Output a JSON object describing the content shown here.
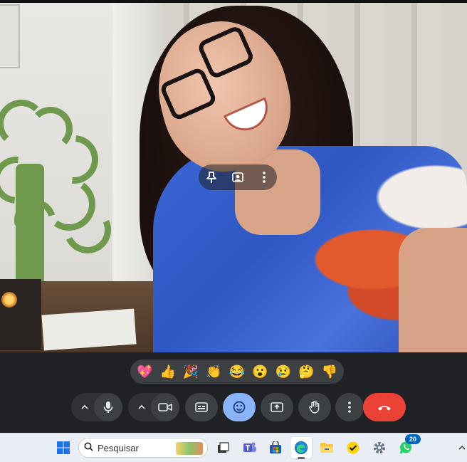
{
  "video": {
    "tile_controls": [
      {
        "icon": "pin-icon"
      },
      {
        "icon": "frame-person-icon"
      },
      {
        "icon": "more-vert-icon"
      }
    ]
  },
  "reactions": [
    {
      "name": "sparkling-heart",
      "glyph": "💖"
    },
    {
      "name": "thumbs-up",
      "glyph": "👍"
    },
    {
      "name": "party-popper",
      "glyph": "🎉"
    },
    {
      "name": "clapping-hands",
      "glyph": "👏"
    },
    {
      "name": "tears-of-joy",
      "glyph": "😂"
    },
    {
      "name": "surprised-face",
      "glyph": "😮"
    },
    {
      "name": "sad-face",
      "glyph": "😢"
    },
    {
      "name": "thinking-face",
      "glyph": "🤔"
    },
    {
      "name": "thumbs-down",
      "glyph": "👎"
    }
  ],
  "controls": {
    "mic": {
      "icon": "mic-icon"
    },
    "camera": {
      "icon": "videocam-icon"
    },
    "captions": {
      "icon": "captions-icon"
    },
    "emoji": {
      "icon": "emoji-icon",
      "active": true
    },
    "present": {
      "icon": "present-screen-icon"
    },
    "raise_hand": {
      "icon": "hand-icon"
    },
    "more": {
      "icon": "more-vert-icon"
    },
    "end_call": {
      "icon": "call-end-icon",
      "color": "#ea4335"
    }
  },
  "taskbar": {
    "search_placeholder": "Pesquisar",
    "apps": [
      {
        "name": "start",
        "icon": "windows-start-icon"
      },
      {
        "name": "task-view",
        "icon": "task-view-icon"
      },
      {
        "name": "teams",
        "icon": "teams-icon"
      },
      {
        "name": "store",
        "icon": "store-icon"
      },
      {
        "name": "edge",
        "icon": "edge-icon",
        "active": true
      },
      {
        "name": "file-explorer",
        "icon": "folder-icon"
      },
      {
        "name": "tasks",
        "icon": "check-app-icon"
      },
      {
        "name": "settings",
        "icon": "gear-icon"
      },
      {
        "name": "whatsapp",
        "icon": "whatsapp-icon",
        "badge": "20"
      }
    ]
  },
  "colors": {
    "bar_bg": "#202124",
    "active_accent": "#8ab4f8",
    "end_call": "#ea4335",
    "taskbar_bg": "#e9eef4"
  }
}
